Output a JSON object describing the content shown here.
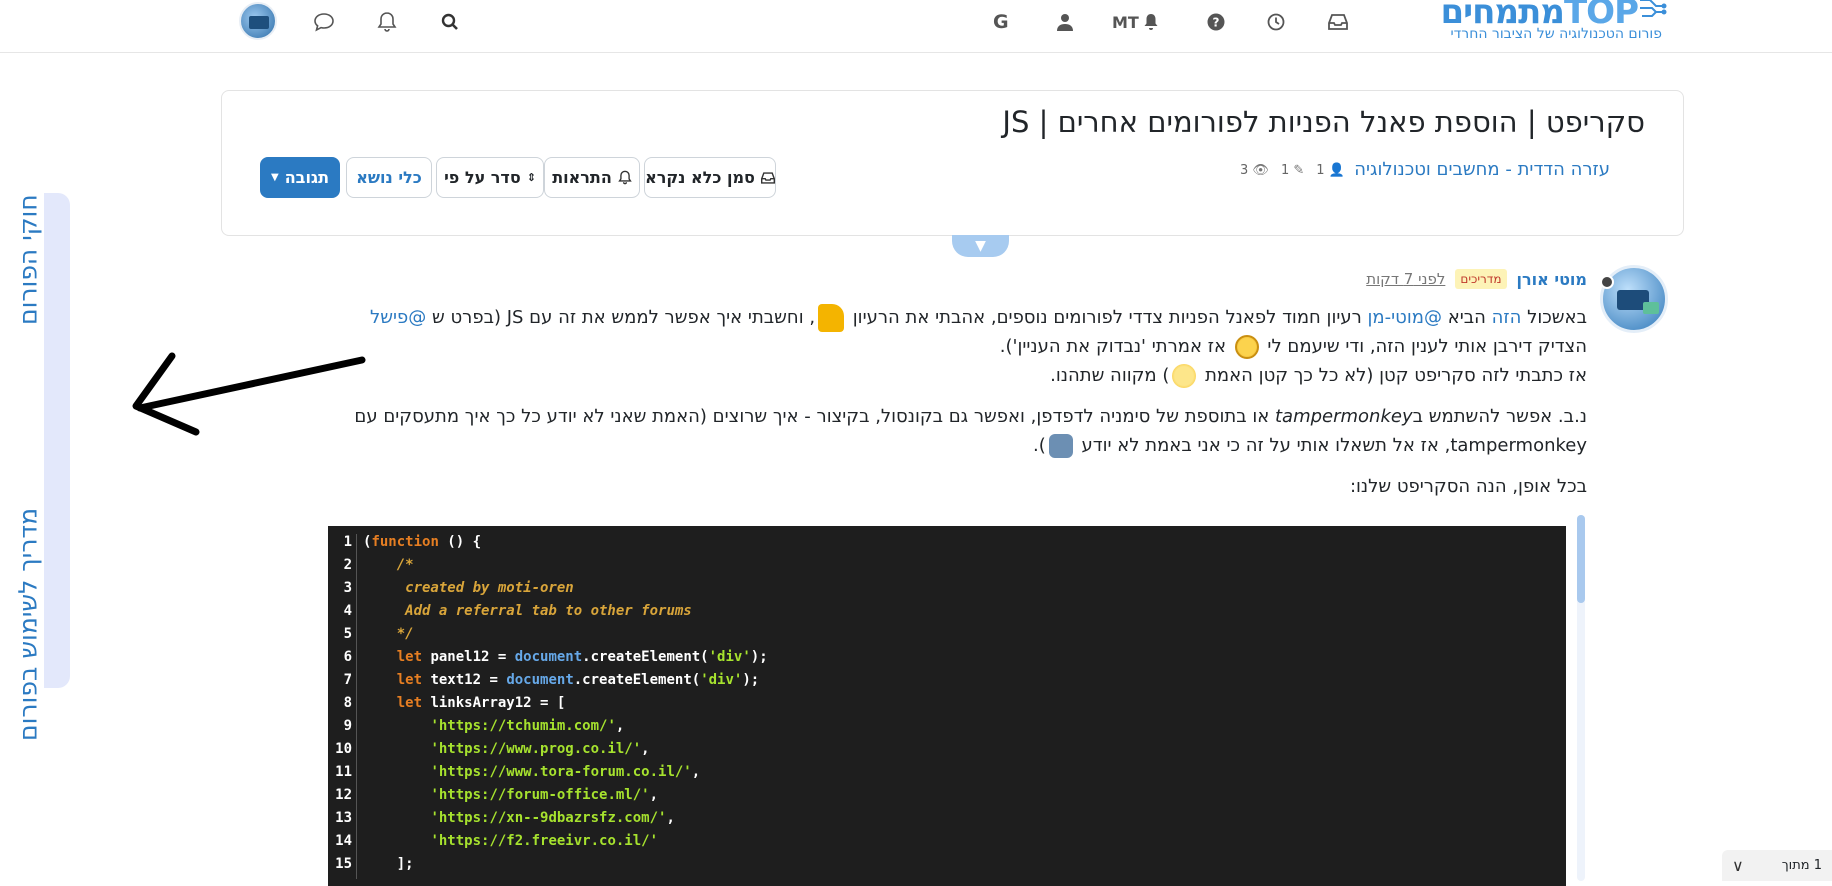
{
  "navbar": {
    "logo_text": "מתמחים",
    "logo_accent": "TOP",
    "logo_tagline": "פורום הטכנולוגיה של הציבור החרדי",
    "user_initials": "MT",
    "icons": [
      "inbox-icon",
      "clock-icon",
      "help-icon",
      "notifications-icon",
      "user-icon",
      "google-icon",
      "search-icon",
      "bell-icon",
      "chat-icon"
    ]
  },
  "side_tabs": {
    "rules": "חוקי הפורום",
    "guide": "מדריך לשימוש בפורום"
  },
  "topic": {
    "title": "סקריפט | הוספת פאנל הפניות לפורומים אחרים | JS",
    "category": "עזרה הדדית - מחשבים וטכנולוגיה",
    "posters_count": "1",
    "posts_count": "1",
    "views_count": "3",
    "buttons": {
      "reply": "תגובה",
      "topic_tools": "כלי נושא",
      "sort_by": "סדר על פי",
      "notifications": "התראות",
      "mark_unread": "סמן כלא נקרא"
    }
  },
  "post": {
    "author": "מוטי אורן",
    "badge": "מדריכים",
    "time": "לפני 7 דקות",
    "para1": {
      "t1": "באשכול ",
      "link1": "הזה",
      "t2": " הביא ",
      "link2": "@מוטי-מן",
      "t3": " רעיון חמוד לפאנל הפניות צדדי לפורומים נוספים, אהבתי את הרעיון ",
      "t4": ", וחשבתי איך אפשר לממש את זה עם JS (בפרט ש ",
      "link3": "@פישל",
      "t5": " הצדיק דירבן אותי לענין הזה, ודי שיעמם לי ",
      "t6": " אז אמרתי 'נבדוק את העניין').",
      "line2": "אז כתבתי לזה סקריפט קטן (לא כל כך קטן האמת ",
      "line2_end": ") מקווה שתהנו."
    },
    "para2": {
      "t1": "נ.ב. אפשר להשתמש ב",
      "em": "tampermonkey",
      "t2": " או בתוספת של סימניה לדפדפן, ואפשר גם בקונסול, בקיצור - איך שרוצים (האמת שאני לא יודע כל כך איך מתעסקים עם tampermonkey, אז אל תשאלו אותי על זה כי אני באמת לא יודע ",
      "t3": ")."
    },
    "para3": "בכל אופן, הנה הסקריפט שלנו:"
  },
  "code": {
    "line_numbers": [
      "1",
      "2",
      "3",
      "4",
      "5",
      "6",
      "7",
      "8",
      "9",
      "10",
      "11",
      "12",
      "13",
      "14",
      "15"
    ],
    "l1_kw": "function",
    "l1_rest": " () {",
    "l2": "/*",
    "l3": " created by moti-oren",
    "l4": " Add a referral tab to other forums",
    "l5": "*/",
    "let": "let",
    "l6_var": " panel12 = ",
    "l6_obj": "document",
    "l6_call": ".createElement(",
    "l6_str": "'div'",
    "l6_end": ");",
    "l7_var": " text12 = ",
    "l7_obj": "document",
    "l7_call": ".createElement(",
    "l7_str": "'div'",
    "l7_end": ");",
    "l8_var": " linksArray12 = [",
    "l9": "'https://tchumim.com/'",
    "l10": "'https://www.prog.co.il/'",
    "l11": "'https://www.tora-forum.co.il/'",
    "l12": "'https://forum-office.ml/'",
    "l13": "'https://xn--9dbazrsfz.com/'",
    "l14": "'https://f2.freeivr.co.il/'",
    "l15": "];"
  },
  "pager": {
    "label": "1 מתוך"
  },
  "colors": {
    "accent": "#2b7ac2",
    "code_bg": "#1e1e1e",
    "side_strip": "#e3e8fb"
  }
}
